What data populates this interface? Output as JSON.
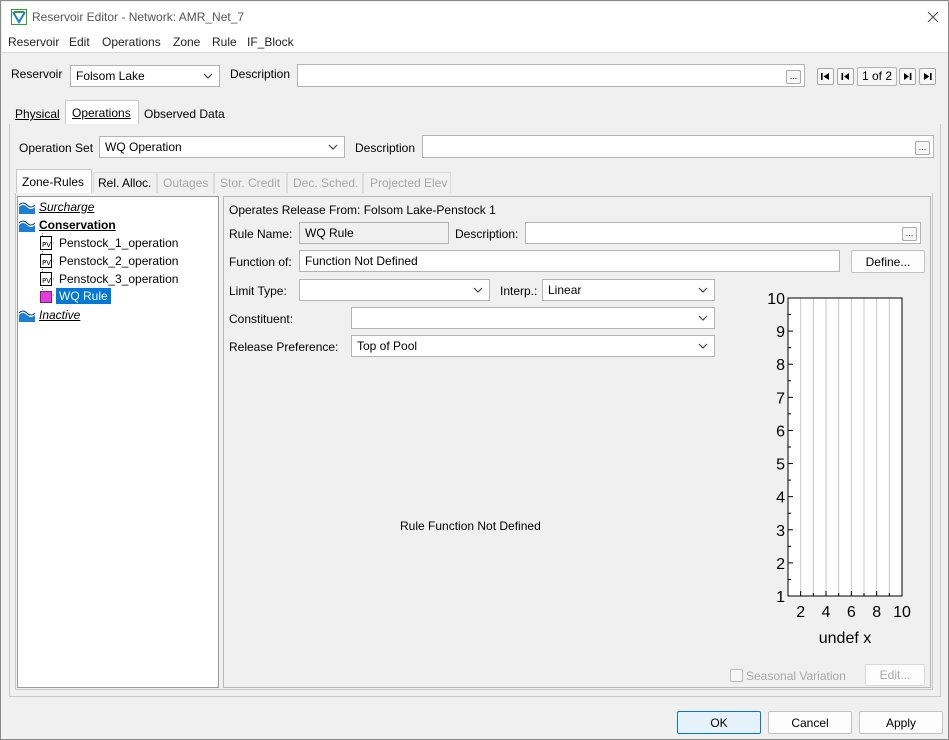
{
  "window": {
    "title": "Reservoir Editor - Network: AMR_Net_7"
  },
  "menu": [
    "Reservoir",
    "Edit",
    "Operations",
    "Zone",
    "Rule",
    "IF_Block"
  ],
  "reservoir": {
    "label": "Reservoir",
    "value": "Folsom Lake",
    "description_label": "Description",
    "description_value": "",
    "pager": "1 of 2"
  },
  "main_tabs": [
    "Physical",
    "Operations",
    "Observed Data"
  ],
  "operation_set": {
    "label": "Operation Set",
    "value": "WQ Operation",
    "description_label": "Description",
    "description_value": ""
  },
  "sub_tabs": [
    "Zone-Rules",
    "Rel. Alloc.",
    "Outages",
    "Stor. Credit",
    "Dec. Sched.",
    "Projected Elev"
  ],
  "tree": {
    "items": [
      {
        "label": "Surcharge"
      },
      {
        "label": "Conservation"
      },
      {
        "label": "Penstock_1_operation"
      },
      {
        "label": "Penstock_2_operation"
      },
      {
        "label": "Penstock_3_operation"
      },
      {
        "label": "WQ Rule"
      },
      {
        "label": "Inactive"
      }
    ]
  },
  "rule": {
    "operates_release_from": "Operates Release From: Folsom Lake-Penstock 1",
    "rule_name_label": "Rule Name:",
    "rule_name_value": "WQ Rule",
    "description_label": "Description:",
    "description_value": "",
    "function_label": "Function of:",
    "function_value": "Function Not Defined",
    "define_button": "Define...",
    "limit_type_label": "Limit Type:",
    "limit_type_value": "",
    "interp_label": "Interp.:",
    "interp_value": "Linear",
    "constituent_label": "Constituent:",
    "constituent_value": "",
    "release_pref_label": "Release Preference:",
    "release_pref_value": "Top of Pool",
    "not_defined_message": "Rule Function Not Defined",
    "seasonal_label": "Seasonal Variation",
    "edit_button": "Edit..."
  },
  "chart_data": {
    "type": "line",
    "xlabel": "undef x",
    "ylabel": "",
    "xlim": [
      1,
      10
    ],
    "ylim": [
      1,
      10
    ],
    "x_ticks": [
      "2",
      "4",
      "6",
      "8",
      "10"
    ],
    "y_ticks": [
      "1",
      "2",
      "3",
      "4",
      "5",
      "6",
      "7",
      "8",
      "9",
      "10"
    ],
    "grid": true,
    "series": []
  },
  "footer": {
    "ok": "OK",
    "cancel": "Cancel",
    "apply": "Apply"
  },
  "colors": {
    "selection": "#0078d7",
    "zone_icon": "#1c7fd6",
    "rule_icon": "#e43cd8"
  }
}
